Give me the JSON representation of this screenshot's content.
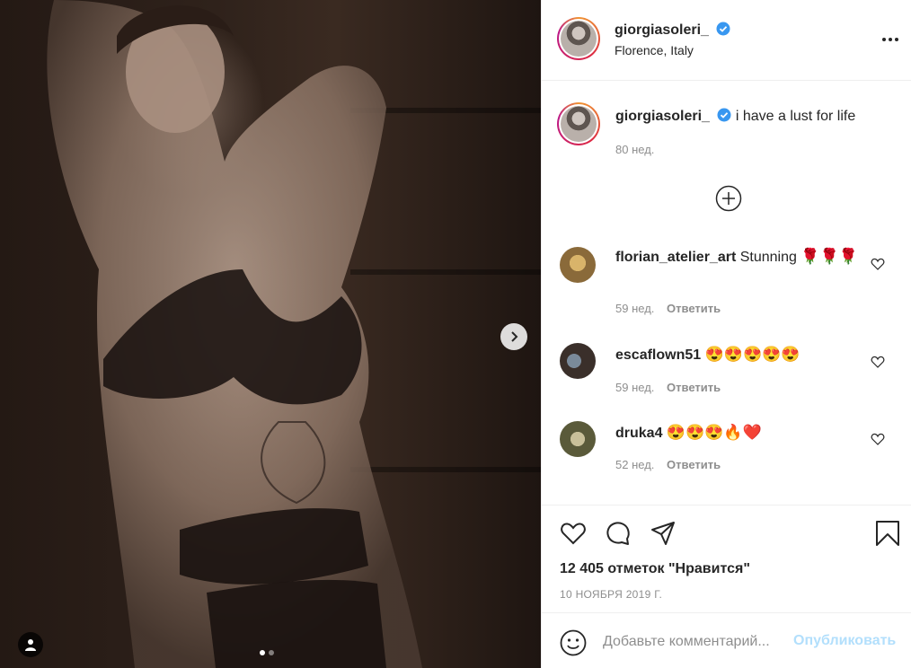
{
  "post": {
    "author": "giorgiasoleri_",
    "location": "Florence, Italy",
    "caption": "i have a lust for life",
    "caption_age": "80 нед.",
    "likes": "12 405 отметок \"Нравится\"",
    "date": "10 НОЯБРЯ 2019 Г."
  },
  "comments": [
    {
      "user": "florian_atelier_art",
      "text": "Stunning",
      "emoji": "🌹🌹🌹",
      "age": "59 нед.",
      "reply": "Ответить"
    },
    {
      "user": "escaflown51",
      "text": "",
      "emoji": "😍😍😍😍😍",
      "age": "59 нед.",
      "reply": "Ответить"
    },
    {
      "user": "druka4",
      "text": "",
      "emoji": "😍😍😍🔥❤️",
      "age": "52 нед.",
      "reply": "Ответить"
    }
  ],
  "add_comment": {
    "placeholder": "Добавьте комментарий...",
    "publish_label": "Опубликовать"
  },
  "colors": {
    "verified": "#3897f0",
    "publish_disabled": "#b2dffc",
    "secondary_text": "#8e8e8e"
  },
  "icons": [
    "chevron-right-icon",
    "user-tag-icon",
    "verified-icon",
    "more-icon",
    "plus-circle-icon",
    "heart-icon",
    "comment-icon",
    "share-icon",
    "bookmark-icon",
    "smile-icon"
  ]
}
